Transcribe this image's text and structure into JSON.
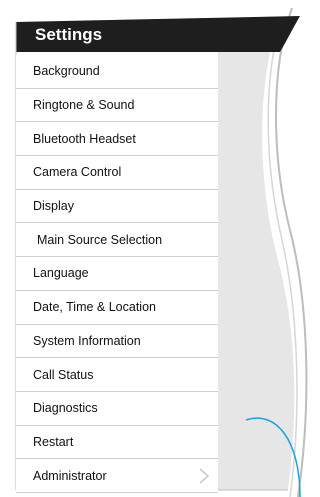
{
  "header": {
    "title": "Settings"
  },
  "menu": {
    "items": [
      {
        "label": "Background"
      },
      {
        "label": "Ringtone & Sound"
      },
      {
        "label": "Bluetooth Headset"
      },
      {
        "label": "Camera Control"
      },
      {
        "label": "Display"
      },
      {
        "label": "Main Source Selection"
      },
      {
        "label": "Language"
      },
      {
        "label": "Date, Time & Location"
      },
      {
        "label": "System Information"
      },
      {
        "label": "Call Status"
      },
      {
        "label": "Diagnostics"
      },
      {
        "label": "Restart"
      },
      {
        "label": "Administrator"
      }
    ]
  },
  "colors": {
    "header_bg": "#1e1e1e",
    "panel_bg": "#e6e6e6",
    "accent_line": "#1aa3d9"
  }
}
